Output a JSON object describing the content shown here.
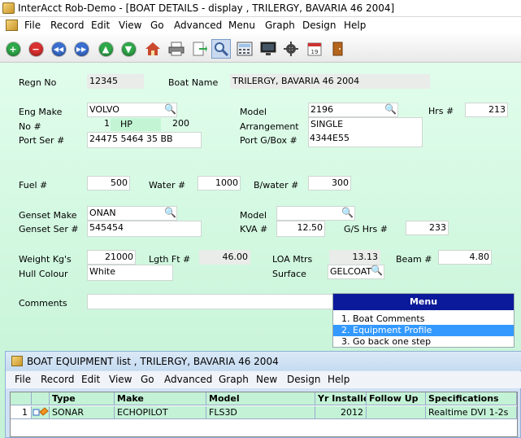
{
  "window": {
    "title": "InterAcct Rob-Demo - [BOAT DETAILS - display , TRILERGY, BAVARIA 46 2004]"
  },
  "menubar": {
    "items": [
      "File",
      "Record",
      "Edit",
      "View",
      "Go",
      "Advanced",
      "Menu",
      "Graph",
      "Design",
      "Help"
    ]
  },
  "toolbar": {
    "buttons": [
      "add-icon",
      "delete-icon",
      "first-record-icon",
      "last-record-icon",
      "previous-icon",
      "next-icon",
      "home-icon",
      "print-icon",
      "export-icon",
      "search-icon",
      "calculator-icon",
      "monitor-icon",
      "settings-icon",
      "calendar-icon",
      "exit-icon"
    ]
  },
  "form": {
    "regn_no": {
      "label": "Regn No",
      "value": "12345"
    },
    "boat_name": {
      "label": "Boat Name",
      "value": "TRILERGY, BAVARIA 46 2004"
    },
    "eng_make": {
      "label": "Eng Make",
      "value": "VOLVO"
    },
    "model": {
      "label": "Model",
      "value": "2196"
    },
    "hrs": {
      "label": "Hrs #",
      "value": "213"
    },
    "no": {
      "label": "No #",
      "value": "1",
      "hp_label": "HP",
      "hp_value": "200"
    },
    "arrangement": {
      "label": "Arrangement",
      "value": "SINGLE"
    },
    "port_ser": {
      "label": "Port Ser #",
      "value": "24475 5464 35 BB"
    },
    "port_gbox": {
      "label": "Port G/Box #",
      "value": "4344E55"
    },
    "fuel": {
      "label": "Fuel #",
      "value": "500"
    },
    "water": {
      "label": "Water #",
      "value": "1000"
    },
    "bwater": {
      "label": "B/water #",
      "value": "300"
    },
    "genset_make": {
      "label": "Genset Make",
      "value": "ONAN"
    },
    "genset_model": {
      "label": "Model",
      "value": ""
    },
    "genset_ser": {
      "label": "Genset Ser #",
      "value": "545454"
    },
    "kva": {
      "label": "KVA #",
      "value": "12.50"
    },
    "gs_hrs": {
      "label": "G/S Hrs #",
      "value": "233"
    },
    "weight": {
      "label": "Weight Kg's",
      "value": "21000"
    },
    "lgth": {
      "label": "Lgth Ft #",
      "value": "46.00"
    },
    "loa": {
      "label": "LOA Mtrs",
      "value": "13.13"
    },
    "beam": {
      "label": "Beam #",
      "value": "4.80"
    },
    "hull_colour": {
      "label": "Hull Colour",
      "value": "White"
    },
    "surface": {
      "label": "Surface",
      "value": "GELCOAT"
    },
    "comments": {
      "label": "Comments",
      "value": ""
    }
  },
  "menu_panel": {
    "title": "Menu",
    "options": [
      "1. Boat Comments",
      "2. Equipment Profile",
      "3. Go back one step"
    ],
    "selected_index": 1
  },
  "child_window": {
    "title": "BOAT EQUIPMENT list , TRILERGY, BAVARIA 46 2004",
    "menubar": [
      "File",
      "Record",
      "Edit",
      "View",
      "Go",
      "Advanced",
      "Graph",
      "New",
      "Design",
      "Help"
    ],
    "columns": [
      "Type",
      "Make",
      "Model",
      "Yr Installed",
      "Follow Up",
      "Specifications"
    ],
    "rows": [
      {
        "num": "1",
        "type": "SONAR",
        "make": "ECHOPILOT",
        "model": "FLS3D",
        "yr_installed": "2012",
        "follow_up": "",
        "specifications": "Realtime DVI 1-2s"
      }
    ]
  },
  "colors": {
    "form_bg": "#d2f8e0",
    "menu_header": "#0b1a9a",
    "menu_selected": "#3399ff"
  }
}
